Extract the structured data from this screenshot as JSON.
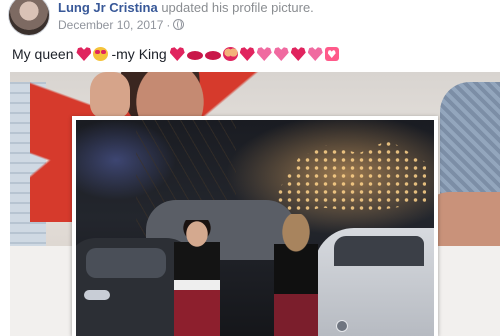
{
  "post": {
    "author_name": "Lung Jr Cristina",
    "action_text": "updated his profile picture.",
    "date": "December 10, 2017",
    "separator": "·",
    "caption_part1": "My queen",
    "caption_part2": "-my King"
  },
  "icons": {
    "privacy": "globe-icon",
    "caption_emojis_1": [
      "red-heart",
      "heart-eyes-face"
    ],
    "caption_emojis_2": [
      "red-heart",
      "kiss-lips",
      "kiss-lips",
      "couple-with-heart",
      "red-heart",
      "sparkling-heart",
      "two-hearts",
      "red-heart",
      "growing-heart",
      "heart-box"
    ]
  },
  "colors": {
    "author_link": "#385898",
    "meta_text": "#90949c",
    "heart": "#e0245e"
  }
}
